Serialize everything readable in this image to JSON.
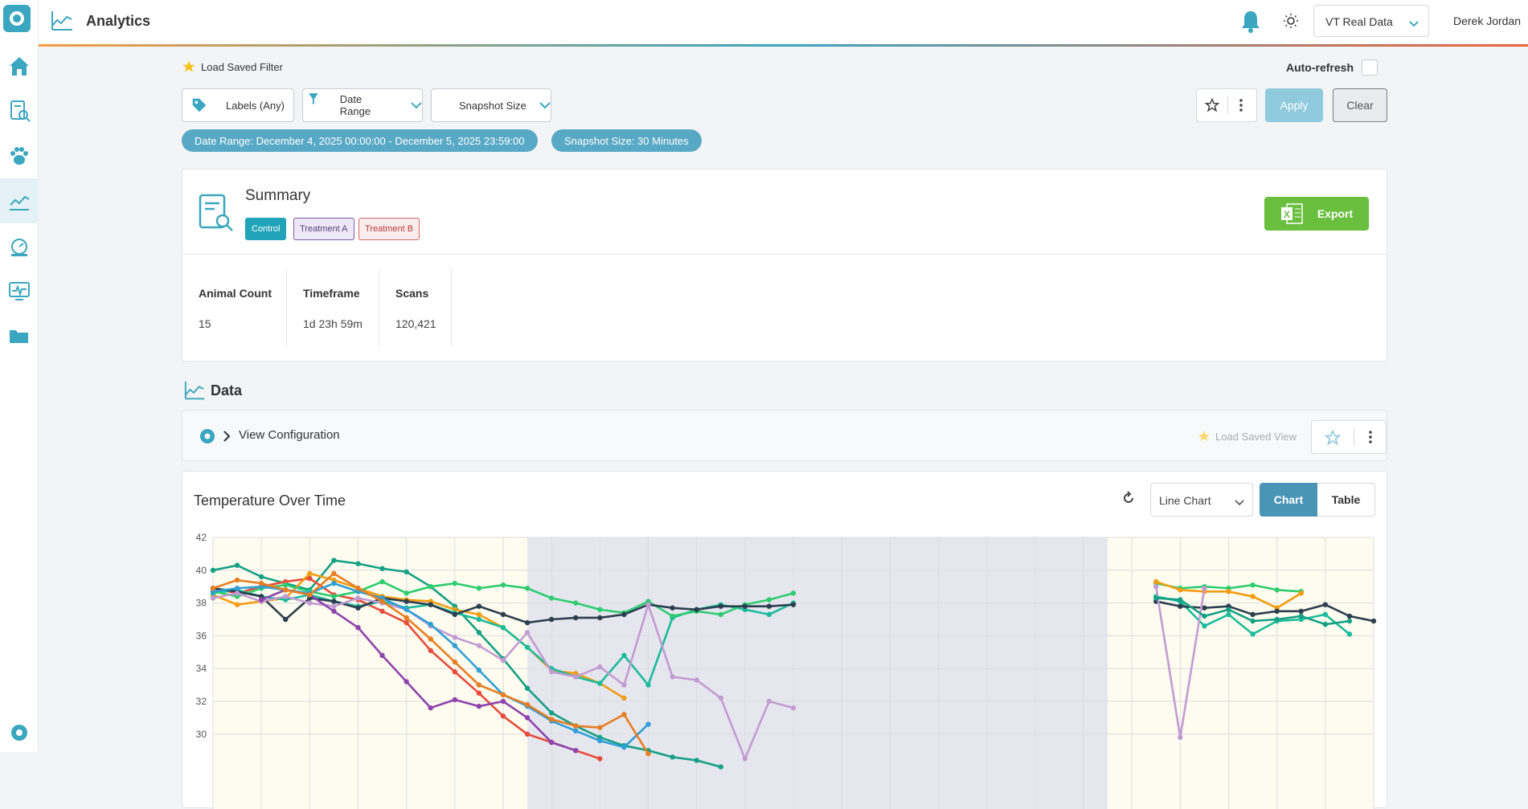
{
  "app": {
    "title": "Analytics"
  },
  "header": {
    "dataset": "VT Real Data",
    "user": "Derek Jordan"
  },
  "filters": {
    "load_saved_filter": "Load Saved Filter",
    "auto_refresh": "Auto-refresh",
    "labels_btn": "Labels (Any)",
    "date_range_btn": "Date Range",
    "snapshot_btn": "Snapshot Size",
    "apply": "Apply",
    "clear": "Clear",
    "chips": [
      "Date Range: December 4, 2025 00:00:00 - December 5, 2025 23:59:00",
      "Snapshot Size: 30 Minutes"
    ]
  },
  "summary": {
    "title": "Summary",
    "tags": [
      "Control",
      "Treatment A",
      "Treatment B"
    ],
    "export": "Export",
    "stats": [
      {
        "label": "Animal Count",
        "value": "15"
      },
      {
        "label": "Timeframe",
        "value": "1d 23h 59m"
      },
      {
        "label": "Scans",
        "value": "120,421"
      }
    ]
  },
  "data_section": {
    "heading": "Data",
    "view_configuration": "View Configuration",
    "load_saved_view": "Load Saved View"
  },
  "chart_panel": {
    "title": "Temperature Over Time",
    "chart_type": "Line Chart",
    "toggle_chart": "Chart",
    "toggle_table": "Table"
  },
  "colors": {
    "accent": "#3aa6bf",
    "export": "#6bbf3f",
    "apply": "#8fcbdc"
  },
  "chart_data": {
    "type": "line",
    "title": "Temperature Over Time",
    "yticks": [
      30,
      32,
      34,
      36,
      38,
      40,
      42
    ],
    "ylim": [
      29,
      42
    ],
    "xlim": [
      0,
      48
    ],
    "shaded_regions": [
      {
        "from": 0,
        "to": 13,
        "color": "#fdfcee"
      },
      {
        "from": 13,
        "to": 37,
        "color": "#e6e7ee"
      },
      {
        "from": 37,
        "to": 48,
        "color": "#fdfcee"
      }
    ],
    "series": [
      {
        "color": "#16a085",
        "values": [
          [
            0,
            40.0
          ],
          [
            1,
            40.3
          ],
          [
            2,
            39.6
          ],
          [
            3,
            39.2
          ],
          [
            4,
            38.8
          ],
          [
            5,
            40.6
          ],
          [
            6,
            40.4
          ],
          [
            7,
            40.1
          ],
          [
            8,
            39.9
          ],
          [
            9,
            39.0
          ],
          [
            10,
            37.8
          ],
          [
            11,
            36.2
          ],
          [
            12,
            34.6
          ],
          [
            13,
            32.8
          ],
          [
            14,
            31.3
          ],
          [
            15,
            30.5
          ],
          [
            16,
            29.8
          ],
          [
            17,
            29.3
          ],
          [
            18,
            29.0
          ],
          [
            19,
            28.6
          ],
          [
            20,
            28.4
          ],
          [
            21,
            28.0
          ]
        ]
      },
      {
        "color": "#e74c3c",
        "values": [
          [
            0,
            38.9
          ],
          [
            1,
            38.6
          ],
          [
            2,
            39.0
          ],
          [
            3,
            39.3
          ],
          [
            4,
            39.5
          ],
          [
            5,
            38.5
          ],
          [
            6,
            38.2
          ],
          [
            7,
            37.5
          ],
          [
            8,
            36.8
          ],
          [
            9,
            35.1
          ],
          [
            10,
            33.8
          ],
          [
            11,
            32.5
          ],
          [
            12,
            31.1
          ],
          [
            13,
            30.0
          ],
          [
            14,
            29.5
          ],
          [
            15,
            29.0
          ],
          [
            16,
            28.5
          ]
        ]
      },
      {
        "color": "#f39c12",
        "values": [
          [
            0,
            38.5
          ],
          [
            1,
            37.9
          ],
          [
            2,
            38.1
          ],
          [
            3,
            38.3
          ],
          [
            4,
            39.8
          ],
          [
            5,
            39.4
          ],
          [
            6,
            38.9
          ],
          [
            7,
            38.4
          ],
          [
            8,
            38.2
          ],
          [
            9,
            38.1
          ],
          [
            10,
            37.6
          ],
          [
            11,
            37.3
          ],
          [
            12,
            36.5
          ],
          [
            13,
            35.3
          ],
          [
            14,
            33.9
          ],
          [
            15,
            33.7
          ],
          [
            16,
            33.1
          ],
          [
            17,
            32.2
          ]
        ]
      },
      {
        "color": "#1abc9c",
        "values": [
          [
            0,
            38.6
          ],
          [
            1,
            38.8
          ],
          [
            2,
            38.4
          ],
          [
            3,
            38.2
          ],
          [
            4,
            38.5
          ],
          [
            5,
            38.1
          ],
          [
            6,
            37.8
          ],
          [
            7,
            38.1
          ],
          [
            8,
            37.7
          ],
          [
            9,
            37.9
          ],
          [
            10,
            37.4
          ],
          [
            11,
            37.0
          ],
          [
            12,
            36.5
          ],
          [
            13,
            35.3
          ],
          [
            14,
            34.0
          ],
          [
            15,
            33.5
          ],
          [
            16,
            33.1
          ],
          [
            17,
            34.8
          ],
          [
            18,
            33.0
          ],
          [
            19,
            37.1
          ],
          [
            20,
            37.6
          ],
          [
            21,
            37.9
          ],
          [
            22,
            37.6
          ],
          [
            23,
            37.3
          ],
          [
            24,
            38.0
          ]
        ]
      },
      {
        "color": "#2ecc71",
        "values": [
          [
            0,
            38.7
          ],
          [
            1,
            38.4
          ],
          [
            2,
            38.9
          ],
          [
            3,
            39.1
          ],
          [
            4,
            38.7
          ],
          [
            5,
            38.4
          ],
          [
            6,
            38.7
          ],
          [
            7,
            39.3
          ],
          [
            8,
            38.6
          ],
          [
            9,
            39.0
          ],
          [
            10,
            39.2
          ],
          [
            11,
            38.9
          ],
          [
            12,
            39.1
          ],
          [
            13,
            38.9
          ],
          [
            14,
            38.3
          ],
          [
            15,
            38.0
          ],
          [
            16,
            37.6
          ],
          [
            17,
            37.4
          ],
          [
            18,
            38.1
          ],
          [
            19,
            37.2
          ],
          [
            20,
            37.5
          ],
          [
            21,
            37.3
          ],
          [
            22,
            37.9
          ],
          [
            23,
            38.2
          ],
          [
            24,
            38.6
          ]
        ]
      },
      {
        "color": "#2c3e50",
        "values": [
          [
            0,
            38.9
          ],
          [
            1,
            38.7
          ],
          [
            2,
            38.4
          ],
          [
            3,
            37.0
          ],
          [
            4,
            38.3
          ],
          [
            5,
            38.1
          ],
          [
            6,
            37.7
          ],
          [
            7,
            38.3
          ],
          [
            8,
            38.1
          ],
          [
            9,
            37.9
          ],
          [
            10,
            37.3
          ],
          [
            11,
            37.8
          ],
          [
            12,
            37.3
          ],
          [
            13,
            36.8
          ],
          [
            14,
            37.0
          ],
          [
            15,
            37.1
          ],
          [
            16,
            37.1
          ],
          [
            17,
            37.3
          ],
          [
            18,
            37.9
          ],
          [
            19,
            37.7
          ],
          [
            20,
            37.6
          ],
          [
            21,
            37.8
          ],
          [
            22,
            37.8
          ],
          [
            23,
            37.8
          ],
          [
            24,
            37.9
          ]
        ]
      },
      {
        "color": "#c39bd3",
        "values": [
          [
            0,
            38.3
          ],
          [
            1,
            38.6
          ],
          [
            2,
            38.1
          ],
          [
            3,
            38.4
          ],
          [
            4,
            38.0
          ],
          [
            5,
            37.8
          ],
          [
            6,
            38.3
          ],
          [
            7,
            38.0
          ],
          [
            8,
            37.6
          ],
          [
            9,
            36.6
          ],
          [
            10,
            35.9
          ],
          [
            11,
            35.4
          ],
          [
            12,
            34.5
          ],
          [
            13,
            36.2
          ],
          [
            14,
            33.8
          ],
          [
            15,
            33.5
          ],
          [
            16,
            34.1
          ],
          [
            17,
            33.0
          ],
          [
            18,
            37.9
          ],
          [
            19,
            33.5
          ],
          [
            20,
            33.3
          ],
          [
            21,
            32.2
          ],
          [
            22,
            28.5
          ],
          [
            23,
            32.0
          ],
          [
            24,
            31.6
          ]
        ]
      },
      {
        "color": "#8e44ad",
        "values": [
          [
            2,
            38.2
          ],
          [
            3,
            38.8
          ],
          [
            4,
            38.5
          ],
          [
            5,
            37.5
          ],
          [
            6,
            36.5
          ],
          [
            7,
            34.8
          ],
          [
            8,
            33.2
          ],
          [
            9,
            31.6
          ],
          [
            10,
            32.1
          ],
          [
            11,
            31.7
          ],
          [
            12,
            32.0
          ],
          [
            13,
            31.0
          ],
          [
            14,
            29.5
          ],
          [
            15,
            29.0
          ]
        ]
      },
      {
        "color": "#2f9fd8",
        "values": [
          [
            0,
            38.7
          ],
          [
            1,
            38.9
          ],
          [
            2,
            39.0
          ],
          [
            3,
            38.8
          ],
          [
            4,
            38.6
          ],
          [
            5,
            39.2
          ],
          [
            6,
            38.7
          ],
          [
            7,
            38.3
          ],
          [
            8,
            37.6
          ],
          [
            9,
            36.7
          ],
          [
            10,
            35.4
          ],
          [
            11,
            33.9
          ],
          [
            12,
            32.4
          ],
          [
            13,
            31.7
          ],
          [
            14,
            30.8
          ],
          [
            15,
            30.2
          ],
          [
            16,
            29.6
          ],
          [
            17,
            29.2
          ],
          [
            18,
            30.6
          ]
        ]
      },
      {
        "color": "#e67e22",
        "values": [
          [
            0,
            38.9
          ],
          [
            1,
            39.4
          ],
          [
            2,
            39.2
          ],
          [
            3,
            38.8
          ],
          [
            4,
            38.5
          ],
          [
            5,
            39.8
          ],
          [
            6,
            38.9
          ],
          [
            7,
            38.1
          ],
          [
            8,
            37.1
          ],
          [
            9,
            35.8
          ],
          [
            10,
            34.4
          ],
          [
            11,
            33.0
          ],
          [
            12,
            32.4
          ],
          [
            13,
            31.8
          ],
          [
            14,
            30.9
          ],
          [
            15,
            30.5
          ],
          [
            16,
            30.4
          ],
          [
            17,
            31.2
          ],
          [
            18,
            28.8
          ]
        ]
      }
    ],
    "series_right": [
      {
        "color": "#2ecc71",
        "values": [
          [
            39,
            39.2
          ],
          [
            40,
            38.9
          ],
          [
            41,
            39.0
          ],
          [
            42,
            38.9
          ],
          [
            43,
            39.1
          ],
          [
            44,
            38.8
          ],
          [
            45,
            38.7
          ]
        ]
      },
      {
        "color": "#f39c12",
        "values": [
          [
            39,
            39.3
          ],
          [
            40,
            38.8
          ],
          [
            41,
            38.7
          ],
          [
            42,
            38.7
          ],
          [
            43,
            38.4
          ],
          [
            44,
            37.7
          ],
          [
            45,
            38.6
          ]
        ]
      },
      {
        "color": "#1abc9c",
        "values": [
          [
            39,
            38.4
          ],
          [
            40,
            38.1
          ],
          [
            41,
            36.6
          ],
          [
            42,
            37.3
          ],
          [
            43,
            36.1
          ],
          [
            44,
            36.9
          ],
          [
            45,
            37.0
          ],
          [
            46,
            37.3
          ],
          [
            47,
            36.1
          ]
        ]
      },
      {
        "color": "#2c3e50",
        "values": [
          [
            39,
            38.1
          ],
          [
            40,
            37.8
          ],
          [
            41,
            37.7
          ],
          [
            42,
            37.8
          ],
          [
            43,
            37.3
          ],
          [
            44,
            37.5
          ],
          [
            45,
            37.5
          ],
          [
            46,
            37.9
          ],
          [
            47,
            37.2
          ],
          [
            48,
            36.9
          ]
        ]
      },
      {
        "color": "#c39bd3",
        "values": [
          [
            39,
            39.0
          ],
          [
            40,
            29.8
          ],
          [
            41,
            38.9
          ]
        ]
      },
      {
        "color": "#16a085",
        "values": [
          [
            39,
            38.3
          ],
          [
            40,
            38.2
          ],
          [
            41,
            37.2
          ],
          [
            42,
            37.6
          ],
          [
            43,
            36.9
          ],
          [
            44,
            37.0
          ],
          [
            45,
            37.2
          ],
          [
            46,
            36.7
          ],
          [
            47,
            36.9
          ]
        ]
      }
    ]
  }
}
